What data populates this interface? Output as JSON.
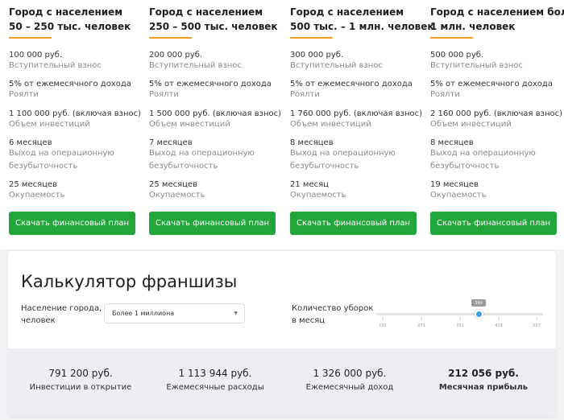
{
  "plans": [
    {
      "title_line1": "Город с населением",
      "title_line2": "50 – 250 тыс. человек",
      "fee_value": "100 000 руб.",
      "fee_label": "Вступительный взнос",
      "royalty_value": "5% от ежемесячного дохода",
      "royalty_label": "Роялти",
      "investment_value": "1 100 000 руб. (включая взнос)",
      "investment_label": "Объем инвестиций",
      "breakeven_value": "6 месяцев",
      "breakeven_label_line1": "Выход на операционную",
      "breakeven_label_line2": "безубыточность",
      "payback_value": "25 месяцев",
      "payback_label": "Окупаемость",
      "button_label": "Скачать финансовый план"
    },
    {
      "title_line1": "Город с населением",
      "title_line2": "250 – 500 тыс. человек",
      "fee_value": "200 000 руб.",
      "fee_label": "Вступительный взнос",
      "royalty_value": "5% от ежемесячного дохода",
      "royalty_label": "Роялти",
      "investment_value": "1 500 000 руб. (включая взнос)",
      "investment_label": "Объем инвестиций",
      "breakeven_value": "7 месяцев",
      "breakeven_label_line1": "Выход на операционную",
      "breakeven_label_line2": "безубыточность",
      "payback_value": "25 месяцев",
      "payback_label": "Окупаемость",
      "button_label": "Скачать финансовый план"
    },
    {
      "title_line1": "Город с населением",
      "title_line2": "500 тыс. – 1 млн. человек",
      "fee_value": "300 000 руб.",
      "fee_label": "Вступительный взнос",
      "royalty_value": "5% от ежемесячного дохода",
      "royalty_label": "Роялти",
      "investment_value": "1 760 000 руб. (включая взнос)",
      "investment_label": "Объем инвестиций",
      "breakeven_value": "8 месяцев",
      "breakeven_label_line1": "Выход на операционную",
      "breakeven_label_line2": "безубыточность",
      "payback_value": "21 месяц",
      "payback_label": "Окупаемость",
      "button_label": "Скачать финансовый план"
    },
    {
      "title_line1": "Город с населением более",
      "title_line2": "1 млн. человек",
      "fee_value": "500 000 руб.",
      "fee_label": "Вступительный взнос",
      "royalty_value": "5% от ежемесячного дохода",
      "royalty_label": "Роялти",
      "investment_value": "2 160 000 руб. (включая взнос)",
      "investment_label": "Объем инвестиций",
      "breakeven_value": "8 месяцев",
      "breakeven_label_line1": "Выход на операционную",
      "breakeven_label_line2": "безубыточность",
      "payback_value": "19 месяцев",
      "payback_label": "Окупаемость",
      "button_label": "Скачать финансовый план"
    }
  ],
  "calculator": {
    "title": "Калькулятор франшизы",
    "population_label_line1": "Население города,",
    "population_label_line2": "человек",
    "population_selected": "Более 1 миллиона",
    "cleanings_label_line1": "Количество уборок",
    "cleanings_label_line2": "в месяц",
    "slider": {
      "value": "390",
      "ticks": [
        "195",
        "273",
        "351",
        "429",
        "507"
      ]
    },
    "results": [
      {
        "value": "791 200 руб.",
        "label": "Инвестиции в открытие"
      },
      {
        "value": "1 113 944 руб.",
        "label": "Ежемесячные расходы"
      },
      {
        "value": "1 326 000 руб.",
        "label": "Ежемесячный доход"
      },
      {
        "value": "212 056 руб.",
        "label": "Месячная прибыль"
      }
    ]
  },
  "colors": {
    "accent_orange": "#f39c1f",
    "button_green": "#22a53a",
    "slider_blue": "#3aa0e0"
  }
}
